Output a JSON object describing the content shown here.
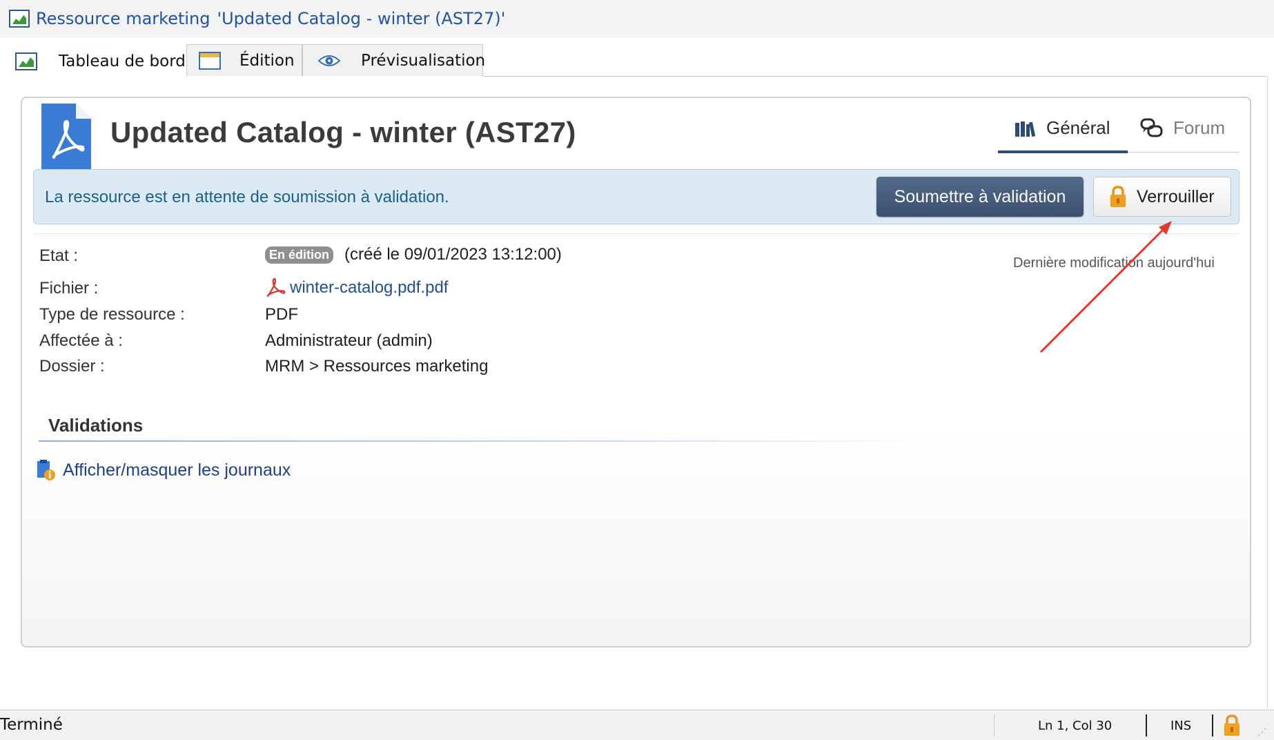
{
  "window": {
    "title_prefix": "Ressource marketing",
    "title_quoted": "'Updated Catalog - winter (AST27)'"
  },
  "tabs": [
    {
      "label": "Tableau de bord",
      "icon": "dashboard-icon",
      "active": true
    },
    {
      "label": "Édition",
      "icon": "edit-window-icon",
      "active": false
    },
    {
      "label": "Prévisualisation",
      "icon": "eye-icon",
      "active": false
    }
  ],
  "resource": {
    "title": "Updated Catalog - winter (AST27)",
    "icon": "pdf-document-icon"
  },
  "view_tabs": {
    "general": "Général",
    "forum": "Forum"
  },
  "banner": {
    "message": "La ressource est en attente de soumission à validation.",
    "submit_label": "Soumettre à validation",
    "lock_label": "Verrouiller"
  },
  "properties": {
    "state_label": "Etat :",
    "state_badge": "En édition",
    "state_created": "(créé le 09/01/2023 13:12:00)",
    "file_label": "Fichier :",
    "file_value": "winter-catalog.pdf.pdf",
    "type_label": "Type de ressource :",
    "type_value": "PDF",
    "assigned_label": "Affectée à :",
    "assigned_value": "Administrateur (admin)",
    "folder_label": "Dossier :",
    "folder_value": "MRM > Ressources marketing",
    "last_modified": "Dernière modification aujourd'hui"
  },
  "validations": {
    "title": "Validations",
    "toggle_logs": "Afficher/masquer les journaux"
  },
  "statusbar": {
    "status": "Terminé",
    "position": "Ln 1, Col 30",
    "mode": "INS"
  },
  "colors": {
    "title_blue": "#1f52a8",
    "submit_button": "#3c5070",
    "banner_bg": "#dceaf5",
    "banner_text": "#1d5f8c",
    "pdf_blue": "#3a7bd5",
    "lock_orange": "#f0a020",
    "annotation_red": "#e8382a"
  }
}
